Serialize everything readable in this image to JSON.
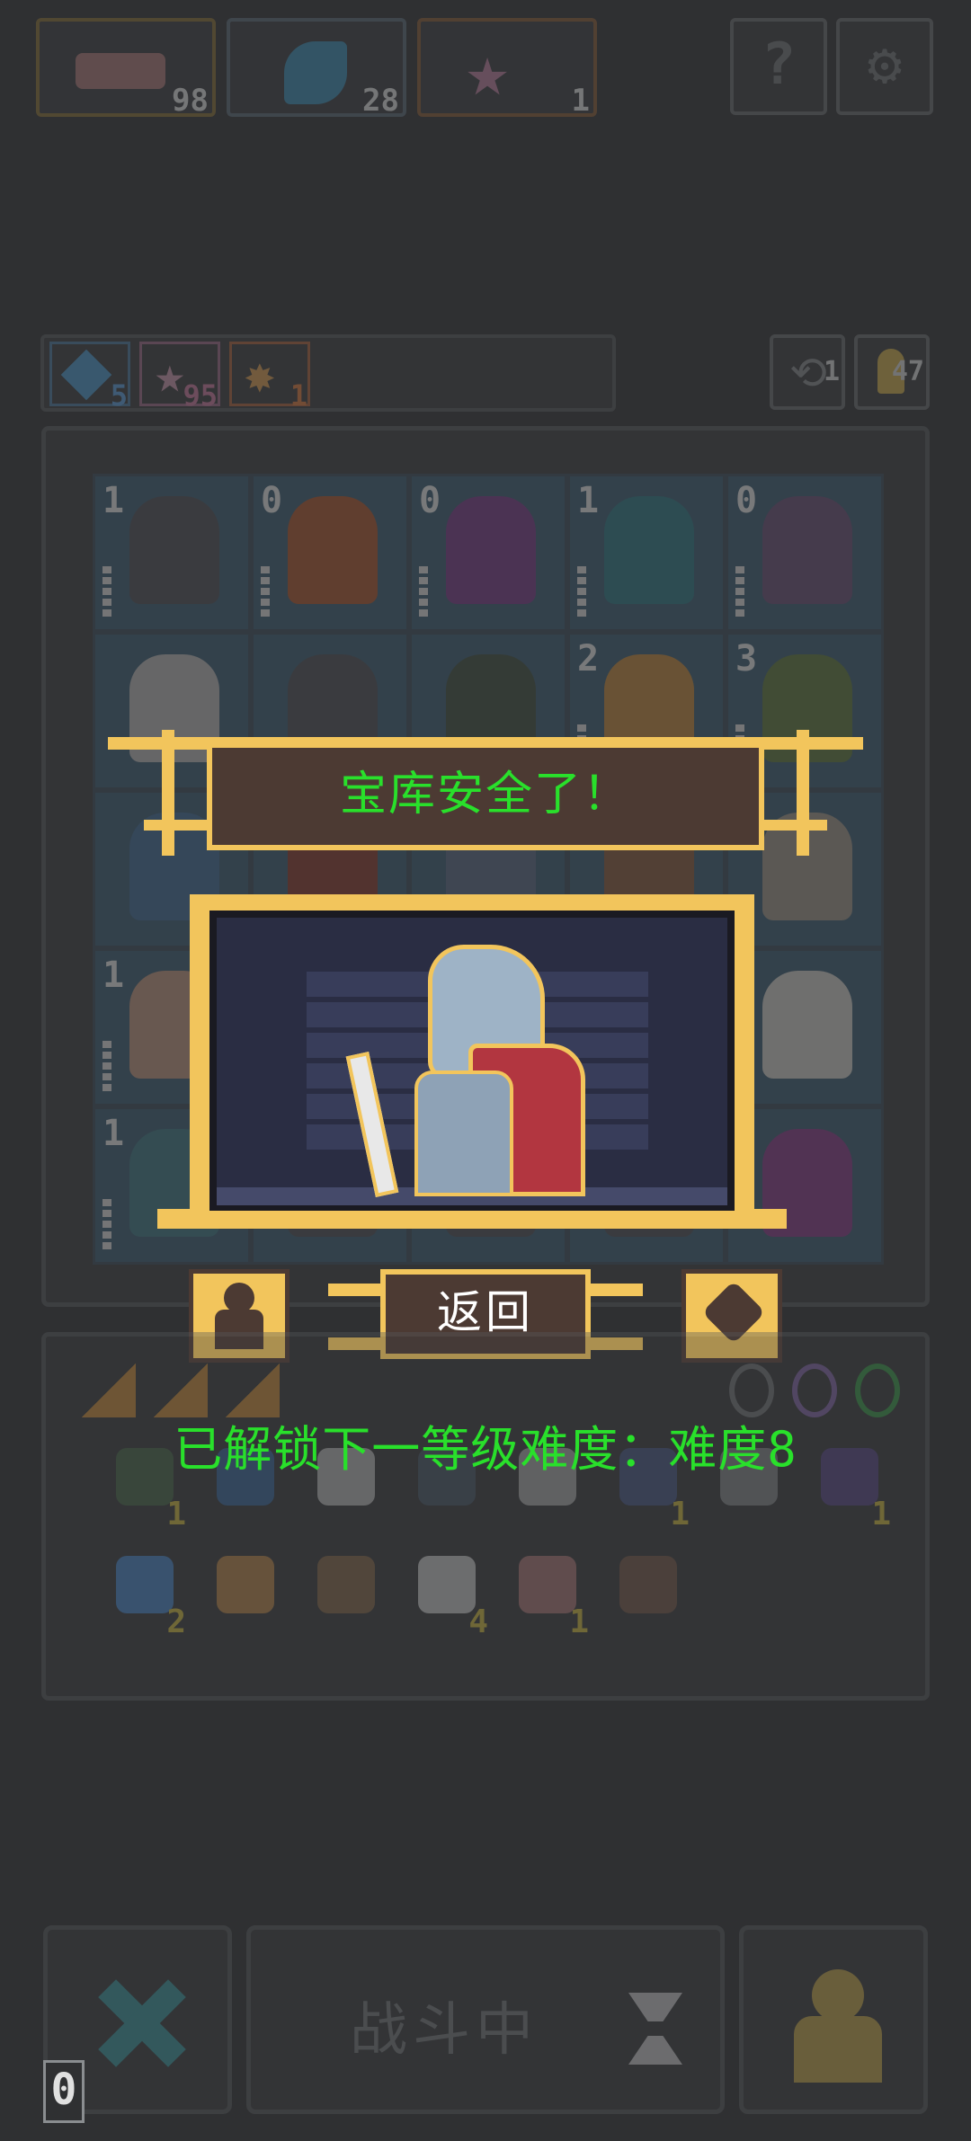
{
  "top_resources": [
    {
      "icon": "wood-plank-icon",
      "count": "98",
      "border": "#8a6f33"
    },
    {
      "icon": "blue-feather-icon",
      "count": "28",
      "border": "#5b6a78"
    },
    {
      "icon": "pink-star-icon",
      "count": "1",
      "border": "#8a5a33"
    }
  ],
  "top_buttons": {
    "help": "?",
    "settings": "⚙"
  },
  "gem_bar": [
    {
      "icon": "blue-gem-icon",
      "count": "5"
    },
    {
      "icon": "pink-gem-icon",
      "count": "95"
    },
    {
      "icon": "orange-gem-icon",
      "count": "1"
    }
  ],
  "small_buttons": [
    {
      "icon": "refresh-icon",
      "count": "1"
    },
    {
      "icon": "key-icon",
      "count": "47"
    }
  ],
  "board": {
    "rows": [
      [
        {
          "lvl": "1",
          "color": "#4e4f55"
        },
        {
          "lvl": "0",
          "color": "#b0552c"
        },
        {
          "lvl": "0",
          "color": "#7a3a8a"
        },
        {
          "lvl": "1",
          "color": "#2b7a86"
        },
        {
          "lvl": "0",
          "color": "#6a4d77"
        }
      ],
      [
        {
          "lvl": "",
          "color": "#bfbfbf"
        },
        {
          "lvl": "",
          "color": "#4d4f55"
        },
        {
          "lvl": "",
          "color": "#3e4e3f"
        },
        {
          "lvl": "2",
          "color": "#c88a3a"
        },
        {
          "lvl": "3",
          "color": "#5f7a3a"
        }
      ],
      [
        {
          "lvl": "",
          "color": "#3f6e9a"
        },
        {
          "lvl": "",
          "color": "#8b3a2c"
        },
        {
          "lvl": "",
          "color": "#5a6a88"
        },
        {
          "lvl": "",
          "color": "#8c5a3a"
        },
        {
          "lvl": "",
          "color": "#a39a8c"
        }
      ],
      [
        {
          "lvl": "1",
          "color": "#c59b82"
        },
        {
          "lvl": "",
          "color": "#4e4f55"
        },
        {
          "lvl": "",
          "color": "#4e4f55"
        },
        {
          "lvl": "",
          "color": "#4e4f55"
        },
        {
          "lvl": "",
          "color": "#d8d6cf"
        }
      ],
      [
        {
          "lvl": "1",
          "color": "#3d7a86"
        },
        {
          "lvl": "",
          "color": "#4e4f55"
        },
        {
          "lvl": "",
          "color": "#4e4f55"
        },
        {
          "lvl": "",
          "color": "#4e4f55"
        },
        {
          "lvl": "",
          "color": "#8a3a8a"
        }
      ]
    ]
  },
  "modal": {
    "title": "宝库安全了！",
    "back_label": "返回",
    "left_icon": "pawn-icon",
    "right_icon": "heart-shield-icon",
    "hero": "armored-knight-sprite"
  },
  "unlock_message": "已解锁下一等级难度：难度8",
  "inventory": {
    "tiles": [
      {
        "icon": "wood-triangle-icon"
      },
      {
        "icon": "wood-triangle-icon"
      },
      {
        "icon": "wood-triangle-icon"
      }
    ],
    "items": [
      {
        "icon": "merchant-icon",
        "count": "1"
      },
      {
        "icon": "bowl-icon",
        "count": ""
      },
      {
        "icon": "scroll-icon",
        "count": ""
      },
      {
        "icon": "camera-icon",
        "count": ""
      },
      {
        "icon": "book-icon",
        "count": ""
      },
      {
        "icon": "flag-icon",
        "count": "1"
      },
      {
        "icon": "sword-icon",
        "count": ""
      },
      {
        "icon": "pagoda-icon",
        "count": "1"
      },
      {
        "icon": "crystal-icon",
        "count": "2"
      },
      {
        "icon": "ship-icon",
        "count": ""
      },
      {
        "icon": "pickaxe-icon",
        "count": ""
      },
      {
        "icon": "dice-icon",
        "count": "4"
      },
      {
        "icon": "wood-plank-icon",
        "count": "1"
      },
      {
        "icon": "hammer-icon",
        "count": ""
      }
    ],
    "rings": [
      {
        "icon": "ring-icon"
      },
      {
        "icon": "ring-icon"
      },
      {
        "icon": "ring-icon"
      }
    ]
  },
  "bottom_bar": {
    "left_count": "0",
    "cancel_icon": "cross-icon",
    "battle_label": "战斗中",
    "hourglass_icon": "hourglass-icon",
    "pawn_icon": "pawn-icon"
  }
}
